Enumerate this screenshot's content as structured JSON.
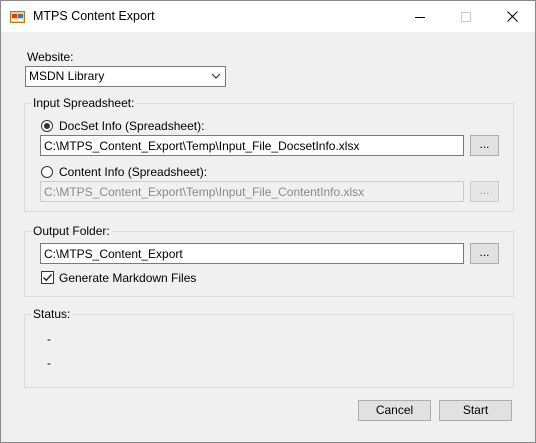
{
  "window": {
    "title": "MTPS Content Export",
    "app_icon": "app-window-icon"
  },
  "website": {
    "label": "Website:",
    "selected": "MSDN Library"
  },
  "input_spreadsheet": {
    "group_label": "Input Spreadsheet:",
    "docset": {
      "label": "DocSet Info (Spreadsheet):",
      "path": "C:\\MTPS_Content_Export\\Temp\\Input_File_DocsetInfo.xlsx",
      "browse_label": "...",
      "selected": true
    },
    "content": {
      "label": "Content Info (Spreadsheet):",
      "path": "C:\\MTPS_Content_Export\\Temp\\Input_File_ContentInfo.xlsx",
      "browse_label": "...",
      "selected": false
    }
  },
  "output": {
    "group_label": "Output Folder:",
    "path": "C:\\MTPS_Content_Export",
    "browse_label": "...",
    "generate_markdown_label": "Generate Markdown Files",
    "generate_markdown_checked": true
  },
  "status": {
    "group_label": "Status:",
    "line1": "-",
    "line2": "-"
  },
  "buttons": {
    "cancel": "Cancel",
    "start": "Start"
  }
}
